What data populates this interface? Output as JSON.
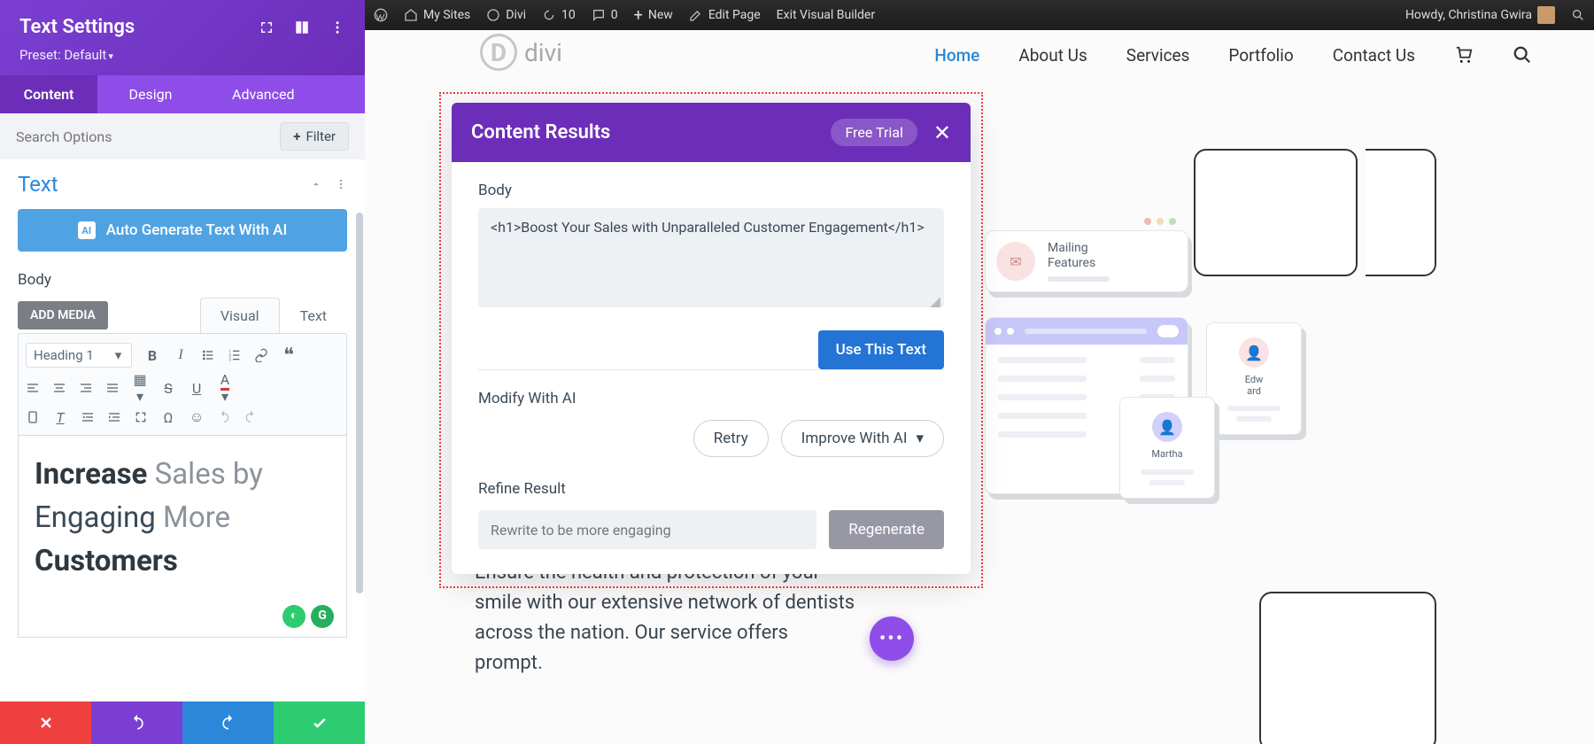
{
  "sidebar": {
    "title": "Text Settings",
    "preset": "Preset: Default",
    "tabs": {
      "content": "Content",
      "design": "Design",
      "advanced": "Advanced"
    },
    "search_placeholder": "Search Options",
    "filter": "Filter",
    "section": "Text",
    "auto_gen": "Auto Generate Text With AI",
    "body_label": "Body",
    "add_media": "ADD MEDIA",
    "ed_tabs": {
      "visual": "Visual",
      "text": "Text"
    },
    "heading_sel": "Heading 1",
    "editor_bold1": "Increase",
    "editor_txt1": "Sales by",
    "editor_txt2": "Engaging",
    "editor_bold2": "More",
    "editor_bold3": "Customers"
  },
  "wpbar": {
    "mysites": "My Sites",
    "divi": "Divi",
    "refresh": "10",
    "comments": "0",
    "new": "New",
    "edit": "Edit Page",
    "exit": "Exit Visual Builder",
    "howdy": "Howdy, Christina Gwira"
  },
  "nav": {
    "logo": "divi",
    "home": "Home",
    "about": "About Us",
    "services": "Services",
    "portfolio": "Portfolio",
    "contact": "Contact Us"
  },
  "popup": {
    "title": "Content Results",
    "free_trial": "Free Trial",
    "body_label": "Body",
    "body_value": "<h1>Boost Your Sales with Unparalleled Customer Engagement</h1>",
    "use": "Use This Text",
    "modify": "Modify With AI",
    "retry": "Retry",
    "improve": "Improve With AI",
    "refine": "Refine Result",
    "refine_placeholder": "Rewrite to be more engaging",
    "regen": "Regenerate"
  },
  "deco": {
    "mailing1": "Mailing",
    "mailing2": "Features",
    "edward": "Edw\nard",
    "martha": "Martha"
  },
  "page_text": "Ensure the health and protection of your smile with our extensive network of dentists across the nation. Our service offers prompt."
}
